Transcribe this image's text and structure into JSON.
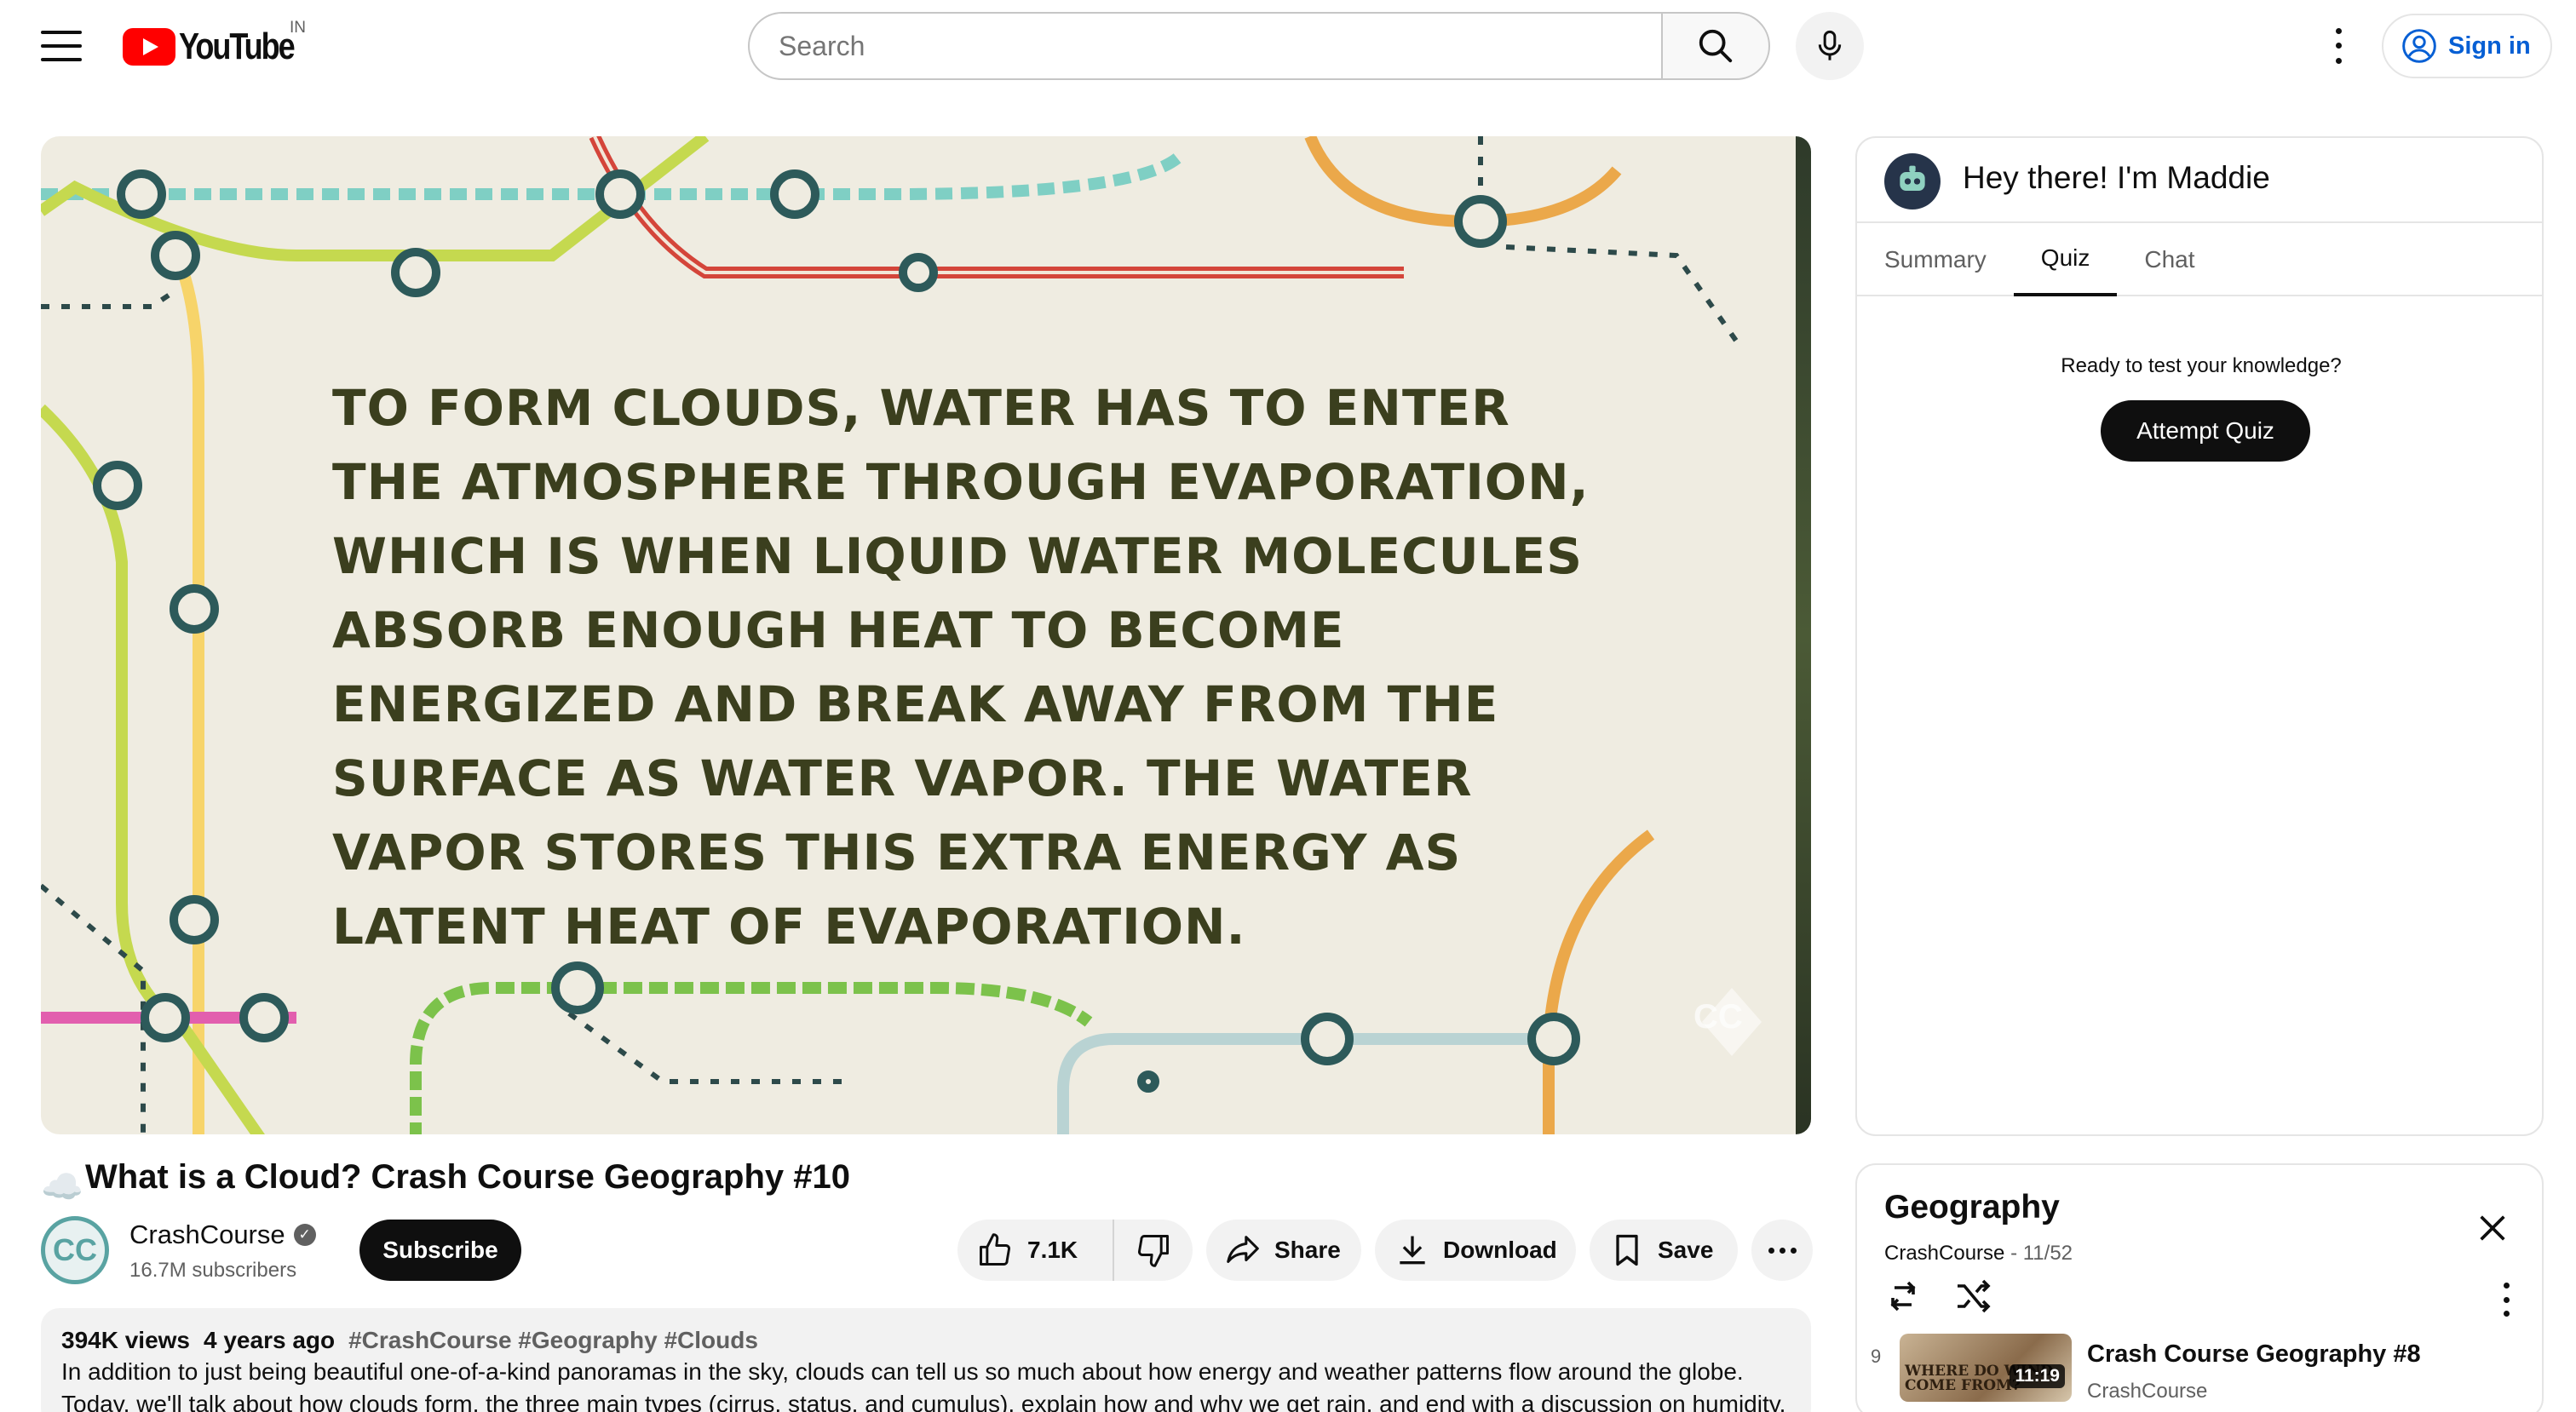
{
  "header": {
    "logo_text": "YouTube",
    "country_code": "IN",
    "search_placeholder": "Search",
    "signin_label": "Sign in"
  },
  "video": {
    "overlay_text": "To form clouds, water has to enter the atmosphere through evaporation, which is when liquid water molecules absorb enough heat to become energized and break away from the surface as water vapor. The water vapor stores this extra energy as latent heat of evaporation.",
    "watermark": "CC",
    "title_emoji": "☁️",
    "title": "What is a Cloud? Crash Course Geography #10"
  },
  "channel": {
    "avatar_text": "CC",
    "name": "CrashCourse",
    "verified_mark": "✓",
    "subscribers": "16.7M subscribers",
    "subscribe_label": "Subscribe"
  },
  "actions": {
    "likes": "7.1K",
    "share_label": "Share",
    "download_label": "Download",
    "save_label": "Save"
  },
  "description": {
    "views": "394K views",
    "age": "4 years ago",
    "hashtags": "#CrashCourse #Geography #Clouds",
    "text": "In addition to just being beautiful one-of-a-kind panoramas in the sky, clouds can tell us so much about how energy and weather patterns flow around the globe. Today, we'll talk about how clouds form, the three main types (cirrus, status, and cumulus), explain how and why we get rain, and end with a discussion on humidity."
  },
  "assistant": {
    "greeting": "Hey there! I'm Maddie",
    "tabs": [
      {
        "label": "Summary"
      },
      {
        "label": "Quiz"
      },
      {
        "label": "Chat"
      }
    ],
    "active_tab": "Quiz",
    "prompt": "Ready to test your knowledge?",
    "button_label": "Attempt Quiz"
  },
  "playlist": {
    "title": "Geography",
    "owner": "CrashCourse",
    "position": "11/52",
    "item": {
      "index": "9",
      "thumb_text": "WHERE DO WIND COME FROM?",
      "duration": "11:19",
      "title": "Crash Course Geography #8",
      "channel": "CrashCourse"
    }
  },
  "colors": {
    "brand_red": "#ff0000",
    "link_blue": "#065fd4",
    "video_bg": "#efece1",
    "video_text": "#3b3f1e"
  }
}
